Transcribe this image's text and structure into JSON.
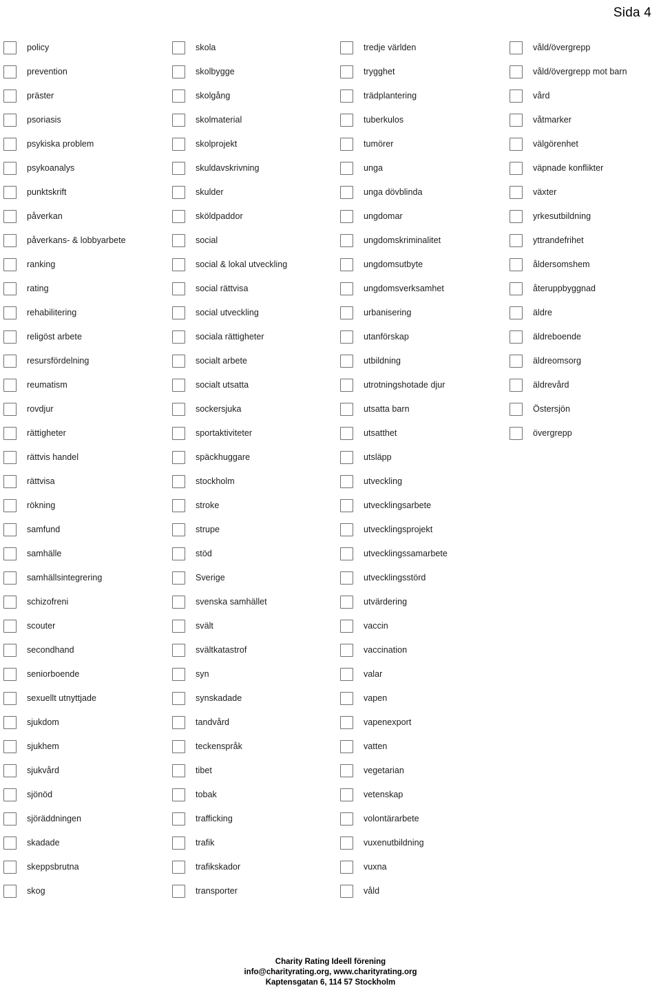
{
  "header": {
    "page_label": "Sida 4"
  },
  "colors": {
    "page_background": "#ffffff",
    "text": "#1c1c1c",
    "checkbox_border": "#707070"
  },
  "checklist": {
    "columns": [
      {
        "name": "column-1",
        "items": [
          "policy",
          "prevention",
          "präster",
          "psoriasis",
          "psykiska problem",
          "psykoanalys",
          "punktskrift",
          "påverkan",
          "påverkans- & lobbyarbete",
          "ranking",
          "rating",
          "rehabilitering",
          "religöst arbete",
          "resursfördelning",
          "reumatism",
          "rovdjur",
          "rättigheter",
          "rättvis handel",
          "rättvisa",
          "rökning",
          "samfund",
          "samhälle",
          "samhällsintegrering",
          "schizofreni",
          "scouter",
          "secondhand",
          "seniorboende",
          "sexuellt utnyttjade",
          "sjukdom",
          "sjukhem",
          "sjukvård",
          "sjönöd",
          "sjöräddningen",
          "skadade",
          "skeppsbrutna",
          "skog"
        ]
      },
      {
        "name": "column-2",
        "items": [
          "skola",
          "skolbygge",
          "skolgång",
          "skolmaterial",
          "skolprojekt",
          "skuldavskrivning",
          "skulder",
          "sköldpaddor",
          "social",
          "social & lokal utveckling",
          "social rättvisa",
          "social utveckling",
          "sociala rättigheter",
          "socialt arbete",
          "socialt utsatta",
          "sockersjuka",
          "sportaktiviteter",
          "späckhuggare",
          "stockholm",
          "stroke",
          "strupe",
          "stöd",
          "Sverige",
          "svenska samhället",
          "svält",
          "svältkatastrof",
          "syn",
          "synskadade",
          "tandvård",
          "teckenspråk",
          "tibet",
          "tobak",
          "trafficking",
          "trafik",
          "trafikskador",
          "transporter"
        ]
      },
      {
        "name": "column-3",
        "items": [
          "tredje världen",
          "trygghet",
          "trädplantering",
          "tuberkulos",
          "tumörer",
          "unga",
          "unga dövblinda",
          "ungdomar",
          "ungdomskriminalitet",
          "ungdomsutbyte",
          "ungdomsverksamhet",
          "urbanisering",
          "utanförskap",
          "utbildning",
          "utrotningshotade djur",
          "utsatta barn",
          "utsatthet",
          "utsläpp",
          "utveckling",
          "utvecklingsarbete",
          "utvecklingsprojekt",
          "utvecklingssamarbete",
          "utvecklingsstörd",
          "utvärdering",
          "vaccin",
          "vaccination",
          "valar",
          "vapen",
          "vapenexport",
          "vatten",
          "vegetarian",
          "vetenskap",
          "volontärarbete",
          "vuxenutbildning",
          "vuxna",
          "våld"
        ]
      },
      {
        "name": "column-4",
        "items": [
          "våld/övergrepp",
          "våld/övergrepp mot barn",
          "vård",
          "våtmarker",
          "välgörenhet",
          "väpnade konflikter",
          "växter",
          "yrkesutbildning",
          "yttrandefrihet",
          "åldersomshem",
          "återuppbyggnad",
          "äldre",
          "äldreboende",
          "äldreomsorg",
          "äldrevård",
          "Östersjön",
          "övergrepp"
        ]
      }
    ]
  },
  "footer": {
    "line1": "Charity Rating Ideell förening",
    "line2": "info@charityrating.org, www.charityrating.org",
    "line3": "Kaptensgatan 6, 114 57 Stockholm"
  }
}
